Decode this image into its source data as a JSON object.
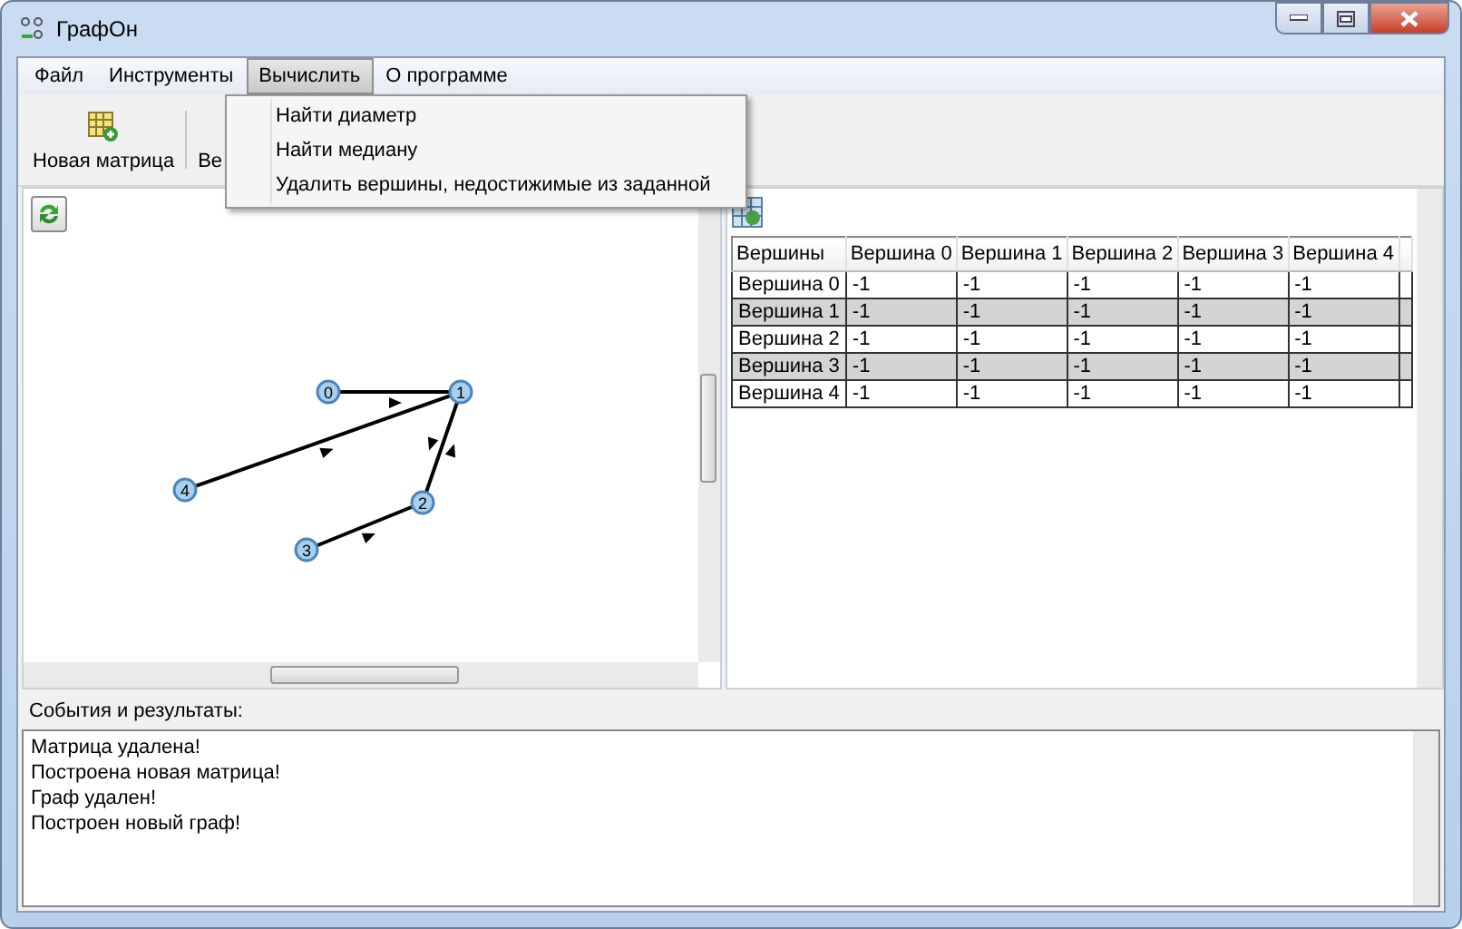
{
  "window": {
    "title": "ГрафОн"
  },
  "menu": [
    {
      "label": "Файл",
      "selected": false
    },
    {
      "label": "Инструменты",
      "selected": false
    },
    {
      "label": "Вычислить",
      "selected": true
    },
    {
      "label": "О программе",
      "selected": false
    }
  ],
  "dropdown": [
    "Найти диаметр",
    "Найти медиану",
    "Удалить вершины, недостижимые из заданной"
  ],
  "toolbar": [
    {
      "label": "Новая матрица"
    },
    {
      "label": "Ве"
    }
  ],
  "graph": {
    "nodes": [
      "0",
      "1",
      "2",
      "3",
      "4"
    ]
  },
  "table": {
    "columns": [
      "Вершины",
      "Вершина 0",
      "Вершина 1",
      "Вершина 2",
      "Вершина 3",
      "Вершина 4"
    ],
    "rows": [
      [
        "Вершина 0",
        "-1",
        "-1",
        "-1",
        "-1",
        "-1"
      ],
      [
        "Вершина 1",
        "-1",
        "-1",
        "-1",
        "-1",
        "-1"
      ],
      [
        "Вершина 2",
        "-1",
        "-1",
        "-1",
        "-1",
        "-1"
      ],
      [
        "Вершина 3",
        "-1",
        "-1",
        "-1",
        "-1",
        "-1"
      ],
      [
        "Вершина 4",
        "-1",
        "-1",
        "-1",
        "-1",
        "-1"
      ]
    ]
  },
  "events": {
    "label": "События и результаты:",
    "lines": [
      "Матрица удалена!",
      "Построена новая матрица!",
      "Граф удален!",
      "Построен новый граф!"
    ]
  }
}
